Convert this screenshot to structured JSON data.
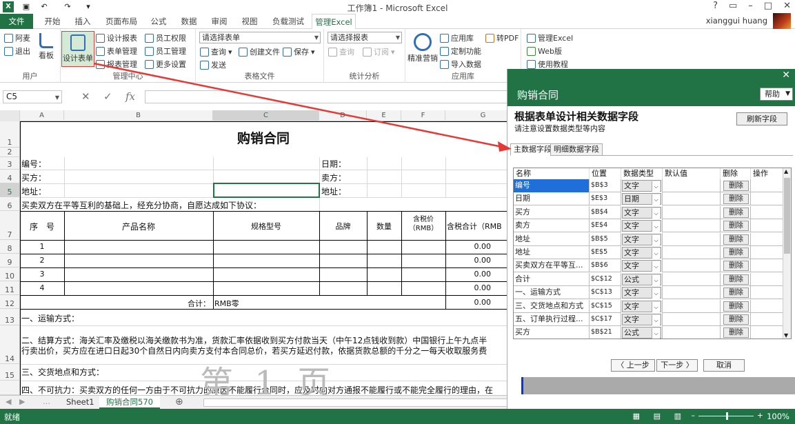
{
  "window": {
    "title": "工作簿1 - Microsoft Excel",
    "help": "?",
    "user": "xianggui huang"
  },
  "tabs": [
    {
      "id": "file",
      "label": "文件"
    },
    {
      "id": "home",
      "label": "开始"
    },
    {
      "id": "insert",
      "label": "插入"
    },
    {
      "id": "layout",
      "label": "页面布局"
    },
    {
      "id": "formula",
      "label": "公式"
    },
    {
      "id": "data",
      "label": "数据"
    },
    {
      "id": "review",
      "label": "审阅"
    },
    {
      "id": "view",
      "label": "视图"
    },
    {
      "id": "load",
      "label": "负载测试"
    },
    {
      "id": "manage",
      "label": "管理Excel"
    }
  ],
  "ribbon": {
    "user_group": {
      "label": "用户",
      "items": [
        "阿麦",
        "退出"
      ]
    },
    "kanban": "看板",
    "design_form": "设计表单",
    "mgmt_group": {
      "label": "管理中心",
      "items": [
        "设计报表",
        "表单管理",
        "报表管理",
        "员工权限",
        "员工管理",
        "更多设置"
      ]
    },
    "form_group": {
      "label": "表格文件",
      "select": "请选择表单",
      "query": "查询",
      "create": "创建文件",
      "save": "保存",
      "send": "发送"
    },
    "stats_group": {
      "label": "统计分析",
      "select": "请选择报表",
      "query": "查询",
      "subscribe": "订阅"
    },
    "apps_group": {
      "label": "应用库",
      "precision": "精准营销",
      "items": [
        "应用库",
        "定制功能",
        "导入数据",
        "转PDF"
      ]
    },
    "more_group": {
      "items": [
        "管理Excel",
        "Web版",
        "使用教程"
      ]
    }
  },
  "formula_bar": {
    "name_box": "C5",
    "fx": "fx"
  },
  "sheet": {
    "columns": [
      "A",
      "B",
      "C",
      "D",
      "E",
      "F",
      "G"
    ],
    "rows": [
      "1",
      "2",
      "3",
      "4",
      "5",
      "6",
      "7",
      "8",
      "9",
      "10",
      "11",
      "12",
      "13",
      "14",
      "15"
    ],
    "title": "购销合同",
    "labels": {
      "no": "编号：",
      "buyer": "买方：",
      "addr": "地址：",
      "date": "日期：",
      "seller": "卖方：",
      "addr2": "地址：",
      "agree": "买卖双方在平等互利的基础上，经充分协商，自愿达成如下协议："
    },
    "table_headers": [
      "序　号",
      "产品名称",
      "规格型号",
      "品牌",
      "数量",
      "含税价（RMB）",
      "含税合计（RMB"
    ],
    "seq": [
      "1",
      "2",
      "3",
      "4"
    ],
    "amount": [
      "0.00",
      "0.00",
      "0.00",
      "0.00"
    ],
    "total_label": "合计：",
    "total_words": "RMB零",
    "total_amount": "0.00",
    "section1": "一、运输方式：",
    "section2": "二、结算方式：海关汇率及缴税以海关缴款书为准，货款汇率依据收到买方付款当天（中午12点钱收到款）中国银行上午九点半",
    "section2b": "行卖出价，买方应在进口日起30个自然日内向卖方支付本合同总价，若买方延迟付款，依据货款总额的千分之一每天收取服务费",
    "section3": "三、交货地点和方式：",
    "section4": "四、不可抗力：买卖双方的任何一方由于不可抗力的原因不能履行合同时，应及时向对方通报不能履行或不能完全履行的理由，在",
    "watermark": "第 1 页"
  },
  "sheet_tabs": [
    "Sheet1",
    "购销合同570"
  ],
  "status": {
    "text": "就绪",
    "zoom": "100%"
  },
  "panel": {
    "title": "购销合同",
    "help": "帮助",
    "heading": "根据表单设计相关数据字段",
    "sub": "请注意设置数据类型等内容",
    "refresh": "刷新字段",
    "tabs": [
      "主数据字段",
      "明细数据字段"
    ],
    "grid_headers": [
      "名称",
      "位置",
      "数据类型",
      "默认值",
      "删除",
      "操作"
    ],
    "rows": [
      {
        "name": "编号",
        "pos": "$B$3",
        "type": "文字"
      },
      {
        "name": "日期",
        "pos": "$E$3",
        "type": "日期"
      },
      {
        "name": "买方",
        "pos": "$B$4",
        "type": "文字"
      },
      {
        "name": "卖方",
        "pos": "$E$4",
        "type": "文字"
      },
      {
        "name": "地址",
        "pos": "$B$5",
        "type": "文字"
      },
      {
        "name": "地址",
        "pos": "$E$5",
        "type": "文字"
      },
      {
        "name": "买卖双方在平等互...",
        "pos": "$B$6",
        "type": "文字"
      },
      {
        "name": "合计",
        "pos": "$C$12",
        "type": "公式"
      },
      {
        "name": "一、运输方式",
        "pos": "$C$13",
        "type": "文字"
      },
      {
        "name": "三、交货地点和方式",
        "pos": "$C$15",
        "type": "文字"
      },
      {
        "name": "五、订单执行过程...",
        "pos": "$C$17",
        "type": "文字"
      },
      {
        "name": "买方",
        "pos": "$B$21",
        "type": "公式"
      }
    ],
    "delete_label": "删除",
    "prev": "〈 上一步",
    "next": "下一步 〉",
    "cancel": "取消"
  },
  "colors": {
    "excel_green": "#217346",
    "arrow_red": "#e53935",
    "highlight": "#e5f0e5"
  }
}
